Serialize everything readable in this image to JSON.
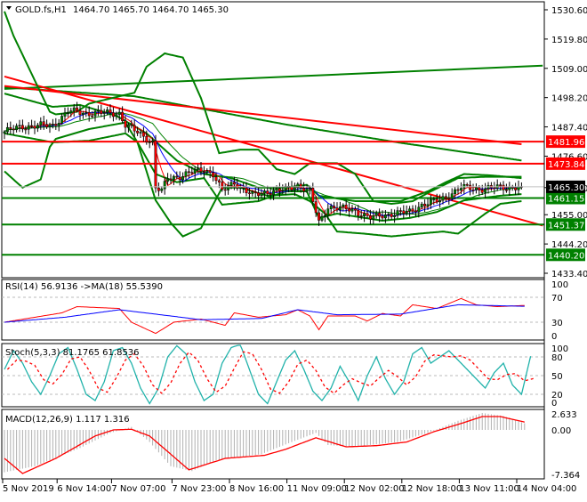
{
  "header": {
    "symbol": "GOLD.fs,H1",
    "ohlc": "1464.70 1465.70 1464.70 1465.30"
  },
  "colors": {
    "bull": "#008000",
    "bear": "#ff0000",
    "band": "#008000",
    "resistance": "#ff0000",
    "support": "#008000",
    "rsi": "#ff0000",
    "rsi_ma": "#0000ff",
    "stoch_k": "#20b2aa",
    "stoch_d": "#ff0000",
    "macd_hist": "#b0b0b0",
    "macd_signal": "#ff0000"
  },
  "chart_data": [
    {
      "type": "candlestick",
      "title": "GOLD.fs,H1",
      "ylim": [
        1433.4,
        1530.6
      ],
      "y_ticks": [
        "1530.60",
        "1519.80",
        "1509.00",
        "1498.20",
        "1487.40",
        "1476.60",
        "1465.00",
        "1455.00",
        "1444.20",
        "1433.40"
      ],
      "y_tick_values": [
        1530.6,
        1519.8,
        1509.0,
        1498.2,
        1487.4,
        1476.6,
        1465.0,
        1455.0,
        1444.2,
        1433.4
      ],
      "x_range_bars": [
        0,
        171
      ],
      "x_ticks": [
        {
          "x": 0,
          "label": "5 Nov 2019"
        },
        {
          "x": 18,
          "label": "6 Nov 14:00"
        },
        {
          "x": 36,
          "label": "7 Nov 07:00"
        },
        {
          "x": 56,
          "label": "7 Nov 23:00"
        },
        {
          "x": 75,
          "label": "8 Nov 16:00"
        },
        {
          "x": 94,
          "label": "11 Nov 09:00"
        },
        {
          "x": 113,
          "label": "12 Nov 02:00"
        },
        {
          "x": 132,
          "label": "12 Nov 18:00"
        },
        {
          "x": 151,
          "label": "13 Nov 11:00"
        },
        {
          "x": 170,
          "label": "14 Nov 04:00"
        }
      ],
      "close_path": [
        [
          0,
          1485.6
        ],
        [
          6,
          1487.6
        ],
        [
          16,
          1488
        ],
        [
          21,
          1493
        ],
        [
          24,
          1493
        ],
        [
          27,
          1492.5
        ],
        [
          38,
          1492.5
        ],
        [
          40,
          1488
        ],
        [
          46,
          1484
        ],
        [
          49,
          1481.7
        ],
        [
          50,
          1465
        ],
        [
          52,
          1463.6
        ],
        [
          54,
          1468.5
        ],
        [
          57,
          1469
        ],
        [
          66,
          1471.8
        ],
        [
          69,
          1470
        ],
        [
          72,
          1463.6
        ],
        [
          76,
          1467
        ],
        [
          82,
          1462
        ],
        [
          87,
          1463.6
        ],
        [
          93,
          1464.2
        ],
        [
          97,
          1466
        ],
        [
          101,
          1463.6
        ],
        [
          104,
          1452
        ],
        [
          107,
          1458
        ],
        [
          116,
          1456.5
        ],
        [
          121,
          1453.8
        ],
        [
          128,
          1455.4
        ],
        [
          134,
          1456
        ],
        [
          138,
          1458.7
        ],
        [
          144,
          1460.3
        ],
        [
          151,
          1465
        ],
        [
          157,
          1464.5
        ],
        [
          163,
          1465
        ],
        [
          171,
          1465.3
        ]
      ],
      "current_price": {
        "value": 1465.3,
        "label": "1465.30"
      },
      "levels": [
        {
          "value": 1481.96,
          "label": "1481.96",
          "kind": "resistance"
        },
        {
          "value": 1473.84,
          "label": "1473.84",
          "kind": "resistance"
        },
        {
          "value": 1461.15,
          "label": "1461.15",
          "kind": "support"
        },
        {
          "value": 1451.37,
          "label": "1451.37",
          "kind": "support"
        },
        {
          "value": 1440.2,
          "label": "1440.20",
          "kind": "support"
        }
      ],
      "trendlines": [
        {
          "kind": "support",
          "from": [
            0,
            1501.4
          ],
          "to": [
            178,
            1510
          ]
        },
        {
          "kind": "resistance",
          "from": [
            0,
            1506
          ],
          "to": [
            178,
            1451
          ]
        },
        {
          "kind": "resistance",
          "from": [
            0,
            1502.5
          ],
          "to": [
            171,
            1481
          ]
        }
      ],
      "long_ma": [
        [
          0,
          1502
        ],
        [
          43,
          1498.7
        ],
        [
          93,
          1488.3
        ],
        [
          130,
          1481.7
        ],
        [
          171,
          1475
        ]
      ],
      "wide_upper": [
        [
          0,
          1530
        ],
        [
          3,
          1521
        ],
        [
          10,
          1504.6
        ],
        [
          15,
          1493
        ],
        [
          17,
          1492
        ],
        [
          24,
          1493
        ],
        [
          28,
          1496
        ],
        [
          43,
          1500
        ],
        [
          47,
          1509.6
        ],
        [
          53,
          1514.5
        ],
        [
          59,
          1513
        ],
        [
          65,
          1498
        ],
        [
          71,
          1477.7
        ],
        [
          78,
          1479
        ],
        [
          84,
          1479
        ],
        [
          90,
          1471.8
        ],
        [
          96,
          1470
        ],
        [
          101,
          1474
        ],
        [
          110,
          1474
        ],
        [
          116,
          1470
        ],
        [
          122,
          1460
        ],
        [
          128,
          1459
        ],
        [
          135,
          1460
        ],
        [
          141,
          1463.6
        ],
        [
          150,
          1468.5
        ],
        [
          159,
          1469
        ],
        [
          171,
          1469
        ]
      ],
      "wide_lower": [
        [
          0,
          1471
        ],
        [
          6,
          1465
        ],
        [
          12,
          1468
        ],
        [
          15,
          1480
        ],
        [
          17,
          1483
        ],
        [
          28,
          1486.6
        ],
        [
          40,
          1489
        ],
        [
          44,
          1481.7
        ],
        [
          50,
          1460.3
        ],
        [
          55,
          1452
        ],
        [
          59,
          1447
        ],
        [
          65,
          1450
        ],
        [
          69,
          1458.7
        ],
        [
          72,
          1465
        ],
        [
          78,
          1465
        ],
        [
          87,
          1462
        ],
        [
          96,
          1462.6
        ],
        [
          101,
          1460
        ],
        [
          106,
          1455.4
        ],
        [
          110,
          1448.8
        ],
        [
          119,
          1448
        ],
        [
          128,
          1447
        ],
        [
          137,
          1448
        ],
        [
          145,
          1448.8
        ],
        [
          150,
          1448
        ],
        [
          159,
          1455.4
        ],
        [
          164,
          1459
        ],
        [
          171,
          1460
        ]
      ],
      "bb_upper": [
        [
          0,
          1499.7
        ],
        [
          16,
          1494.8
        ],
        [
          25,
          1495.5
        ],
        [
          37,
          1491.5
        ],
        [
          47,
          1485
        ],
        [
          57,
          1475
        ],
        [
          66,
          1470
        ],
        [
          75,
          1468.5
        ],
        [
          84,
          1465
        ],
        [
          93,
          1465
        ],
        [
          100,
          1466
        ],
        [
          104,
          1462
        ],
        [
          116,
          1460
        ],
        [
          131,
          1460
        ],
        [
          140,
          1463.6
        ],
        [
          146,
          1467
        ],
        [
          152,
          1470
        ],
        [
          161,
          1469.5
        ],
        [
          171,
          1468.5
        ]
      ],
      "bb_lower": [
        [
          0,
          1485
        ],
        [
          16,
          1481.7
        ],
        [
          28,
          1482.3
        ],
        [
          40,
          1485
        ],
        [
          44,
          1481.7
        ],
        [
          50,
          1470
        ],
        [
          57,
          1467
        ],
        [
          66,
          1468.5
        ],
        [
          72,
          1458.7
        ],
        [
          84,
          1460
        ],
        [
          93,
          1463.6
        ],
        [
          100,
          1463.6
        ],
        [
          104,
          1453.8
        ],
        [
          110,
          1455.4
        ],
        [
          125,
          1452.8
        ],
        [
          134,
          1453.8
        ],
        [
          143,
          1456
        ],
        [
          152,
          1460.3
        ],
        [
          164,
          1462
        ],
        [
          171,
          1462.6
        ]
      ]
    },
    {
      "type": "line",
      "title": "RSI(14) 56.9136  ->MA(18) 55.5390",
      "ylim": [
        0,
        100
      ],
      "y_ticks": [
        {
          "v": 100,
          "label": "100"
        },
        {
          "v": 70,
          "label": "70"
        },
        {
          "v": 30,
          "label": "30"
        },
        {
          "v": 0,
          "label": "0"
        }
      ],
      "series": [
        {
          "name": "RSI(14)",
          "points": [
            [
              0,
              30
            ],
            [
              19,
              45
            ],
            [
              24,
              55
            ],
            [
              38,
              52
            ],
            [
              42,
              30
            ],
            [
              50,
              12
            ],
            [
              56,
              30
            ],
            [
              65,
              35
            ],
            [
              73,
              25
            ],
            [
              76,
              45
            ],
            [
              84,
              38
            ],
            [
              93,
              42
            ],
            [
              97,
              50
            ],
            [
              101,
              40
            ],
            [
              104,
              18
            ],
            [
              107,
              40
            ],
            [
              116,
              40
            ],
            [
              120,
              32
            ],
            [
              125,
              44
            ],
            [
              131,
              40
            ],
            [
              135,
              58
            ],
            [
              143,
              52
            ],
            [
              147,
              60
            ],
            [
              151,
              68
            ],
            [
              156,
              58
            ],
            [
              163,
              55
            ],
            [
              172,
              56.9
            ]
          ]
        },
        {
          "name": "MA(18)",
          "points": [
            [
              0,
              30
            ],
            [
              20,
              38
            ],
            [
              38,
              50
            ],
            [
              55,
              40
            ],
            [
              65,
              34
            ],
            [
              85,
              36
            ],
            [
              97,
              50
            ],
            [
              110,
              42
            ],
            [
              131,
              43
            ],
            [
              150,
              58
            ],
            [
              172,
              55.5
            ]
          ]
        }
      ]
    },
    {
      "type": "line",
      "title": "Stoch(5,3,3) 81.1765 61.8536",
      "ylim": [
        0,
        100
      ],
      "y_ticks": [
        {
          "v": 100,
          "label": "100"
        },
        {
          "v": 80,
          "label": "80"
        },
        {
          "v": 50,
          "label": "50"
        },
        {
          "v": 20,
          "label": "20"
        },
        {
          "v": 0,
          "label": "0"
        }
      ],
      "k_step_bars": 3,
      "k_values": [
        60,
        90,
        70,
        40,
        20,
        50,
        85,
        95,
        60,
        20,
        10,
        40,
        90,
        95,
        70,
        30,
        5,
        30,
        80,
        98,
        85,
        40,
        10,
        20,
        70,
        95,
        100,
        60,
        20,
        5,
        40,
        75,
        90,
        60,
        25,
        10,
        30,
        65,
        40,
        10,
        50,
        80,
        45,
        20,
        40,
        85,
        95,
        70,
        80,
        90,
        75,
        60,
        45,
        30,
        55,
        70,
        35,
        20,
        81.2
      ]
    },
    {
      "type": "bar+line",
      "title": "MACD(12,26,9) 1.117 1.316",
      "ylim": [
        -7.364,
        2.633
      ],
      "y_ticks": [
        {
          "v": 2.633,
          "label": "2.633"
        },
        {
          "v": 0,
          "label": "0.00"
        },
        {
          "v": -7.364,
          "label": "-7.364"
        }
      ],
      "histogram": [
        [
          0,
          -7
        ],
        [
          10,
          -6
        ],
        [
          25,
          -3
        ],
        [
          35,
          -0.5
        ],
        [
          42,
          0.5
        ],
        [
          48,
          -2
        ],
        [
          55,
          -6
        ],
        [
          62,
          -6.8
        ],
        [
          70,
          -5
        ],
        [
          85,
          -4
        ],
        [
          95,
          -2
        ],
        [
          103,
          -0.5
        ],
        [
          107,
          -2.5
        ],
        [
          115,
          -2.8
        ],
        [
          130,
          -2
        ],
        [
          140,
          -0.5
        ],
        [
          150,
          1.5
        ],
        [
          158,
          2.8
        ],
        [
          165,
          2.3
        ],
        [
          172,
          1.1
        ]
      ],
      "signal": [
        [
          0,
          -4.7
        ],
        [
          6,
          -7.2
        ],
        [
          17,
          -4.7
        ],
        [
          30,
          -1
        ],
        [
          36,
          0
        ],
        [
          42,
          0.1
        ],
        [
          48,
          -1
        ],
        [
          61,
          -6.6
        ],
        [
          73,
          -4.7
        ],
        [
          86,
          -4.2
        ],
        [
          93,
          -3.2
        ],
        [
          103,
          -1.3
        ],
        [
          113,
          -2.8
        ],
        [
          123,
          -2.6
        ],
        [
          133,
          -2
        ],
        [
          142,
          -0.3
        ],
        [
          150,
          0.9
        ],
        [
          158,
          2.2
        ],
        [
          164,
          2.2
        ],
        [
          172,
          1.3
        ]
      ]
    }
  ]
}
